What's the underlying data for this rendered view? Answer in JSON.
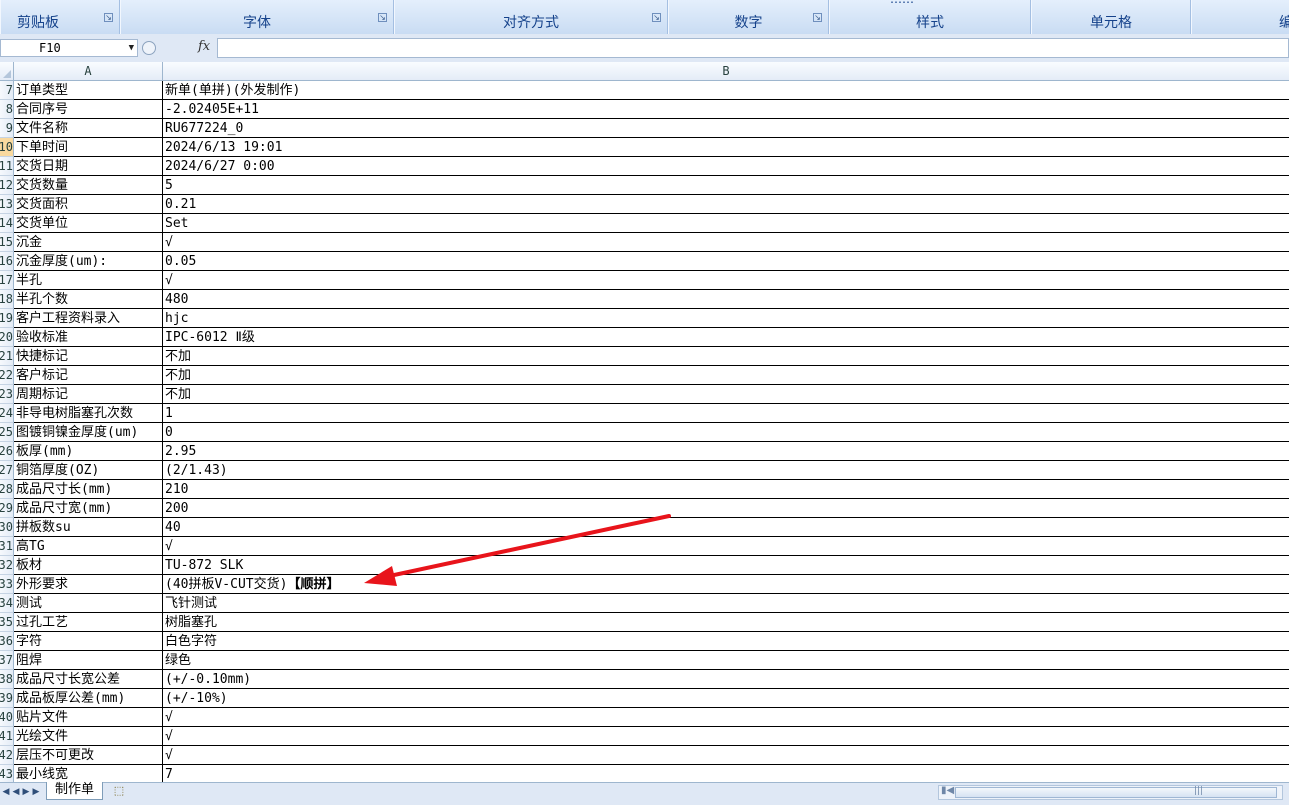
{
  "ribbon": {
    "groups": [
      {
        "label": "剪贴板",
        "launcher": true
      },
      {
        "label": "字体",
        "launcher": true
      },
      {
        "label": "对齐方式",
        "launcher": true
      },
      {
        "label": "数字",
        "launcher": true
      },
      {
        "label": "样式",
        "launcher": false
      },
      {
        "label": "单元格",
        "launcher": false
      },
      {
        "label": "编",
        "launcher": false
      }
    ],
    "partial_top_text": "……"
  },
  "formula_bar": {
    "cell_ref": "F10",
    "fx_label": "fx",
    "formula": ""
  },
  "columns": {
    "a": "A",
    "b": "B"
  },
  "rows": [
    {
      "num": "7",
      "a": "订单类型",
      "b": "新单(单拼)(外发制作)"
    },
    {
      "num": "8",
      "a": "合同序号",
      "b": "-2.02405E+11"
    },
    {
      "num": "9",
      "a": "文件名称",
      "b": "RU677224_0"
    },
    {
      "num": "10",
      "a": "下单时间",
      "b": "2024/6/13 19:01"
    },
    {
      "num": "11",
      "a": "交货日期",
      "b": "2024/6/27 0:00"
    },
    {
      "num": "12",
      "a": "交货数量",
      "b": "5"
    },
    {
      "num": "13",
      "a": "交货面积",
      "b": "0.21"
    },
    {
      "num": "14",
      "a": "交货单位",
      "b": "Set"
    },
    {
      "num": "15",
      "a": "沉金",
      "b": "√"
    },
    {
      "num": "16",
      "a": "沉金厚度(um):",
      "b": "0.05"
    },
    {
      "num": "17",
      "a": "半孔",
      "b": "√"
    },
    {
      "num": "18",
      "a": "半孔个数",
      "b": "480"
    },
    {
      "num": "19",
      "a": "客户工程资料录入",
      "b": "hjc"
    },
    {
      "num": "20",
      "a": "验收标准",
      "b": "IPC-6012 Ⅱ级"
    },
    {
      "num": "21",
      "a": "快捷标记",
      "b": "不加"
    },
    {
      "num": "22",
      "a": "客户标记",
      "b": "不加"
    },
    {
      "num": "23",
      "a": "周期标记",
      "b": "不加"
    },
    {
      "num": "24",
      "a": "非导电树脂塞孔次数",
      "b": "1"
    },
    {
      "num": "25",
      "a": "图镀铜镍金厚度(um)",
      "b": "0"
    },
    {
      "num": "26",
      "a": "板厚(mm)",
      "b": "2.95"
    },
    {
      "num": "27",
      "a": "铜箔厚度(OZ)",
      "b": "(2/1.43)"
    },
    {
      "num": "28",
      "a": "成品尺寸长(mm)",
      "b": "210"
    },
    {
      "num": "29",
      "a": "成品尺寸宽(mm)",
      "b": "200"
    },
    {
      "num": "30",
      "a": "拼板数su",
      "b": "40"
    },
    {
      "num": "31",
      "a": "高TG",
      "b": "√"
    },
    {
      "num": "32",
      "a": "板材",
      "b": "TU-872 SLK"
    },
    {
      "num": "33",
      "a": "外形要求",
      "b": "(40拼板V-CUT交货)",
      "b_bold": "【顺拼】"
    },
    {
      "num": "34",
      "a": "测试",
      "b": "飞针测试"
    },
    {
      "num": "35",
      "a": "过孔工艺",
      "b": "树脂塞孔"
    },
    {
      "num": "36",
      "a": "字符",
      "b": "白色字符"
    },
    {
      "num": "37",
      "a": "阻焊",
      "b": "绿色"
    },
    {
      "num": "38",
      "a": "成品尺寸长宽公差",
      "b": "(+/-0.10mm)"
    },
    {
      "num": "39",
      "a": "成品板厚公差(mm)",
      "b": "(+/-10%)"
    },
    {
      "num": "40",
      "a": "贴片文件",
      "b": "√"
    },
    {
      "num": "41",
      "a": "光绘文件",
      "b": "√"
    },
    {
      "num": "42",
      "a": "层压不可更改",
      "b": "√"
    },
    {
      "num": "43",
      "a": "最小线宽",
      "b": "7"
    }
  ],
  "active_row": "10",
  "sheet_tabs": [
    {
      "label": "制作单",
      "active": true
    }
  ],
  "colors": {
    "annotation_arrow": "#e8141b",
    "ribbon_text": "#15428b",
    "active_header": "#f9d99f"
  }
}
